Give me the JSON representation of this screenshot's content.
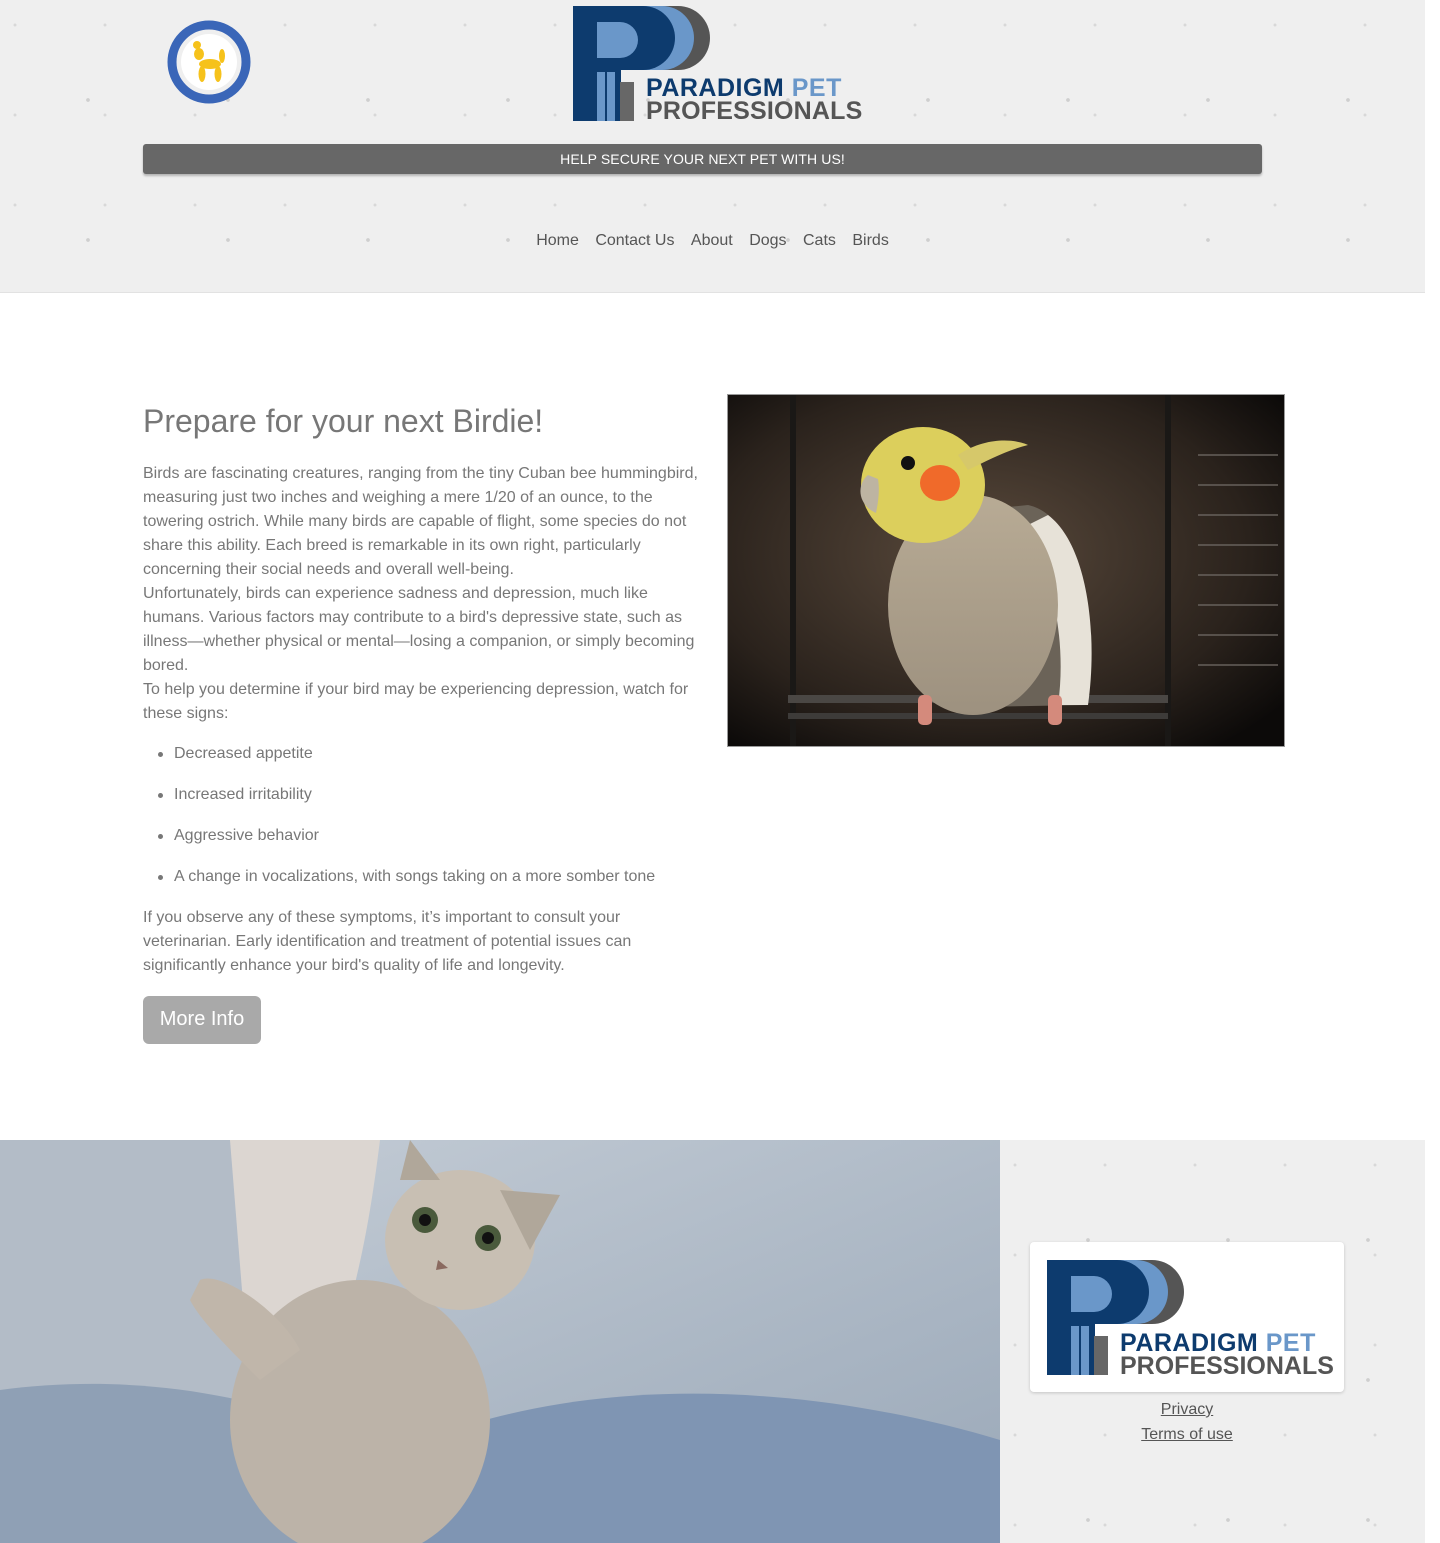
{
  "header": {
    "brand_line1": "PARADIGM",
    "brand_line1b": "PET",
    "brand_line2": "PROFESSIONALS",
    "banner": "HELP SECURE YOUR NEXT PET WITH US!",
    "side_logo_icon": "balloon-dog-icon"
  },
  "nav": {
    "items": [
      {
        "label": "Home"
      },
      {
        "label": "Contact Us"
      },
      {
        "label": "About"
      },
      {
        "label": "Dogs"
      },
      {
        "label": "Cats"
      },
      {
        "label": "Birds"
      }
    ]
  },
  "main": {
    "title": "Prepare for your next Birdie!",
    "para1": "Birds are fascinating creatures, ranging from the tiny Cuban bee hummingbird, measuring just two inches and weighing a mere 1/20 of an ounce, to the towering ostrich. While many birds are capable of flight, some species do not share this ability. Each breed is remarkable in its own right, particularly concerning their social needs and overall well-being.",
    "para2": "Unfortunately, birds can experience sadness and depression, much like humans. Various factors may contribute to a bird's depressive state, such as illness—whether physical or mental—losing a companion, or simply becoming bored.",
    "para3": "To help you determine if your bird may be experiencing depression, watch for these signs:",
    "signs": [
      "Decreased appetite",
      "Increased irritability",
      "Aggressive behavior",
      "A change in vocalizations, with songs taking on a more somber tone"
    ],
    "para4": "If you observe any of these symptoms, it’s important to consult your veterinarian. Early identification and treatment of potential issues can significantly enhance your bird's quality of life and longevity.",
    "more_button": "More Info"
  },
  "footer": {
    "privacy": "Privacy",
    "terms": "Terms of use"
  },
  "colors": {
    "navy": "#0d3b6e",
    "light_blue": "#6a97c9",
    "gray": "#676767",
    "orange": "#f4a01c",
    "ring_blue": "#3a66b8"
  }
}
